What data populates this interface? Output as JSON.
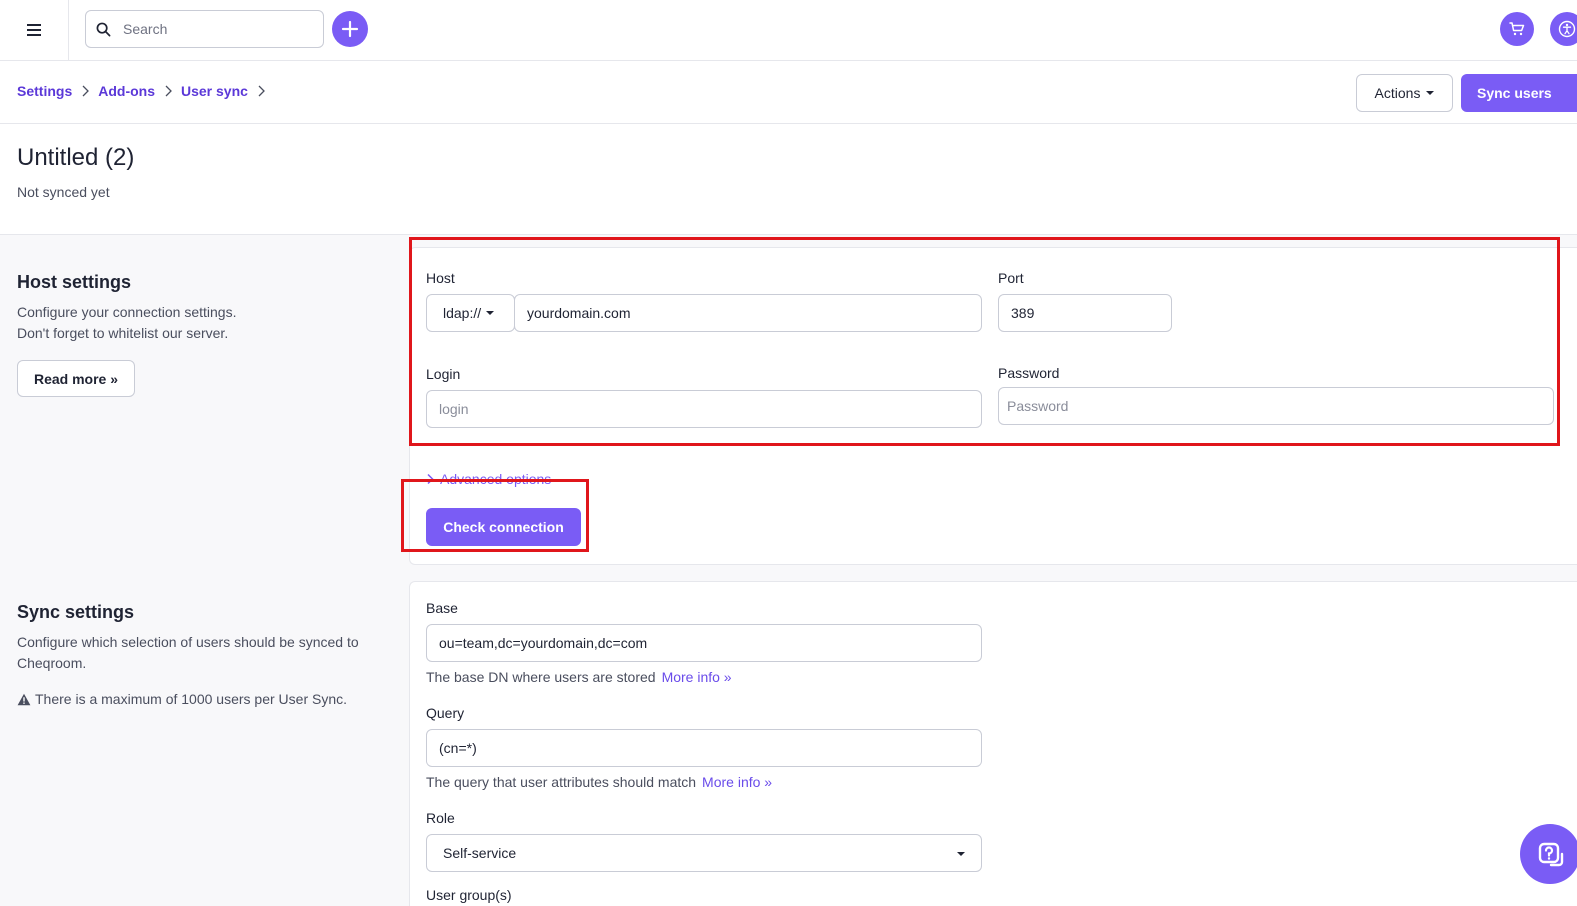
{
  "topbar": {
    "search_placeholder": "Search",
    "icons": [
      "hamburger-menu-icon",
      "search-icon",
      "plus-icon",
      "cart-icon",
      "accessibility-icon"
    ]
  },
  "breadcrumb": {
    "items": [
      "Settings",
      "Add-ons",
      "User sync"
    ]
  },
  "header_actions": {
    "actions_label": "Actions",
    "sync_label": "Sync users"
  },
  "page": {
    "title": "Untitled (2)",
    "subtitle": "Not synced yet"
  },
  "host_section": {
    "title": "Host settings",
    "desc_line1": "Configure your connection settings.",
    "desc_line2": "Don't forget to whitelist our server.",
    "read_more": "Read more »",
    "host_label": "Host",
    "protocol": "ldap://",
    "host_value": "yourdomain.com",
    "port_label": "Port",
    "port_value": "389",
    "login_label": "Login",
    "login_placeholder": "login",
    "password_label": "Password",
    "password_placeholder": "Password",
    "advanced_options": "Advanced options",
    "check_connection": "Check connection"
  },
  "sync_section": {
    "title": "Sync settings",
    "desc_line1": "Configure which selection of users should be synced to",
    "desc_line2": "Cheqroom.",
    "warning": "There is a maximum of 1000 users per User Sync.",
    "base_label": "Base",
    "base_value": "ou=team,dc=yourdomain,dc=com",
    "base_help": "The base DN where users are stored",
    "base_more": "More info »",
    "query_label": "Query",
    "query_value": "(cn=*)",
    "query_help": "The query that user attributes should match",
    "query_more": "More info »",
    "role_label": "Role",
    "role_value": "Self-service",
    "groups_label": "User group(s)"
  },
  "colors": {
    "accent": "#7a5cf5",
    "link": "#5b38d8",
    "highlight": "#e0161b"
  }
}
